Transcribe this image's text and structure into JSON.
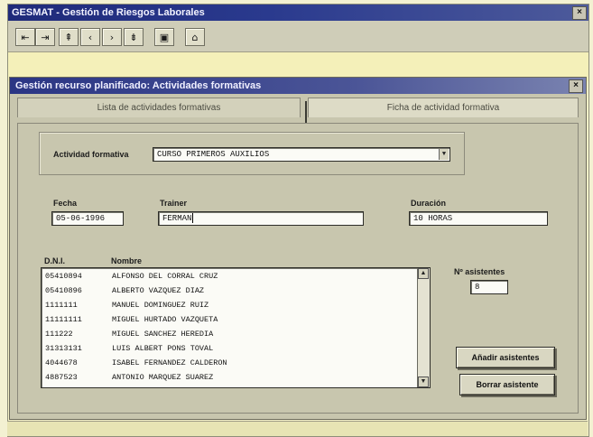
{
  "app": {
    "title": "GESMAT - Gestión de Riesgos Laborales",
    "close_glyph": "×"
  },
  "toolbar": {
    "buttons": [
      {
        "glyph": "⇤",
        "name": "first-record-icon"
      },
      {
        "glyph": "⇥",
        "name": "last-record-icon"
      },
      {
        "glyph": "⇞",
        "name": "page-up-icon"
      },
      {
        "glyph": "‹",
        "name": "previous-icon"
      },
      {
        "glyph": "›",
        "name": "next-icon"
      },
      {
        "glyph": "⇟",
        "name": "page-down-icon"
      },
      {
        "glyph": "▣",
        "name": "save-icon"
      },
      {
        "glyph": "⌂",
        "name": "exit-icon"
      }
    ]
  },
  "window": {
    "title": "Gestión recurso planificado: Actividades formativas",
    "close_glyph": "×",
    "tabs": [
      {
        "label": "Lista de actividades formativas"
      },
      {
        "label": "Ficha de actividad formativa"
      }
    ]
  },
  "form": {
    "activity_label": "Actividad formativa",
    "activity_value": "CURSO PRIMEROS AUXILIOS",
    "dropdown_arrow": "▼",
    "date_label": "Fecha",
    "date_value": "05-06-1996",
    "trainer_label": "Trainer",
    "trainer_value": "FERMAN",
    "duration_label": "Duración",
    "duration_value": "10 HORAS",
    "dni_header": "D.N.I.",
    "name_header": "Nombre",
    "attendees": [
      {
        "dni": "05410894",
        "name": "ALFONSO DEL CORRAL CRUZ"
      },
      {
        "dni": "05410896",
        "name": "ALBERTO VAZQUEZ DIAZ"
      },
      {
        "dni": "1111111",
        "name": "MANUEL DOMINGUEZ RUIZ"
      },
      {
        "dni": "11111111",
        "name": "MIGUEL HURTADO VAZQUETA"
      },
      {
        "dni": "111222",
        "name": "MIGUEL SANCHEZ HEREDIA"
      },
      {
        "dni": "31313131",
        "name": "LUIS ALBERT PONS TOVAL"
      },
      {
        "dni": "4044678",
        "name": "ISABEL FERNANDEZ CALDERON"
      },
      {
        "dni": "4887523",
        "name": "ANTONIO MARQUEZ SUAREZ"
      }
    ],
    "scroll_up": "▲",
    "scroll_down": "▼",
    "attendees_count_label": "Nº asistentes",
    "attendees_count_value": "8",
    "add_button": "Añadir asistentes",
    "remove_button": "Borrar asistente"
  }
}
